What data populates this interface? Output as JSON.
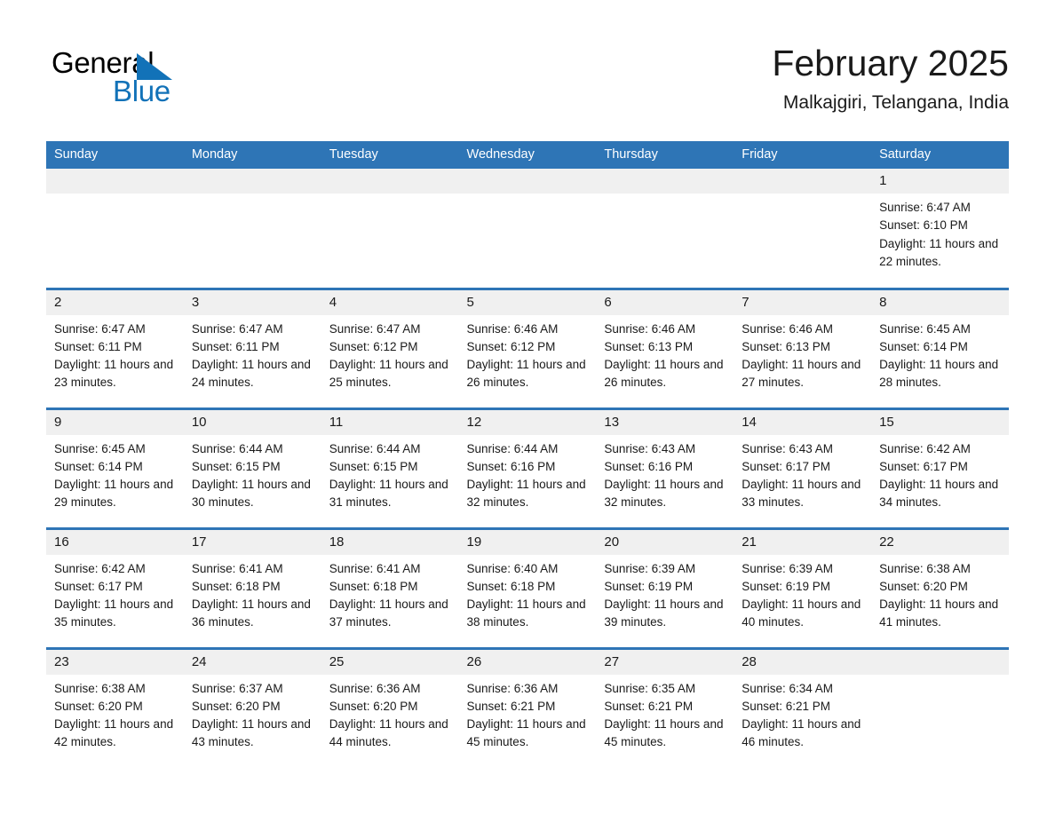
{
  "brand": {
    "name_part1": "General",
    "name_part2": "Blue",
    "accent_color": "#1272b8"
  },
  "header": {
    "title": "February 2025",
    "location": "Malkajgiri, Telangana, India"
  },
  "theme": {
    "header_row_color": "#2e75b6",
    "day_band_color": "#f0f0f0",
    "text_color": "#1a1a1a"
  },
  "weekdays": [
    "Sunday",
    "Monday",
    "Tuesday",
    "Wednesday",
    "Thursday",
    "Friday",
    "Saturday"
  ],
  "weeks": [
    [
      {
        "day": "",
        "empty": true
      },
      {
        "day": "",
        "empty": true
      },
      {
        "day": "",
        "empty": true
      },
      {
        "day": "",
        "empty": true
      },
      {
        "day": "",
        "empty": true
      },
      {
        "day": "",
        "empty": true
      },
      {
        "day": "1",
        "sunrise": "Sunrise: 6:47 AM",
        "sunset": "Sunset: 6:10 PM",
        "daylight": "Daylight: 11 hours and 22 minutes."
      }
    ],
    [
      {
        "day": "2",
        "sunrise": "Sunrise: 6:47 AM",
        "sunset": "Sunset: 6:11 PM",
        "daylight": "Daylight: 11 hours and 23 minutes."
      },
      {
        "day": "3",
        "sunrise": "Sunrise: 6:47 AM",
        "sunset": "Sunset: 6:11 PM",
        "daylight": "Daylight: 11 hours and 24 minutes."
      },
      {
        "day": "4",
        "sunrise": "Sunrise: 6:47 AM",
        "sunset": "Sunset: 6:12 PM",
        "daylight": "Daylight: 11 hours and 25 minutes."
      },
      {
        "day": "5",
        "sunrise": "Sunrise: 6:46 AM",
        "sunset": "Sunset: 6:12 PM",
        "daylight": "Daylight: 11 hours and 26 minutes."
      },
      {
        "day": "6",
        "sunrise": "Sunrise: 6:46 AM",
        "sunset": "Sunset: 6:13 PM",
        "daylight": "Daylight: 11 hours and 26 minutes."
      },
      {
        "day": "7",
        "sunrise": "Sunrise: 6:46 AM",
        "sunset": "Sunset: 6:13 PM",
        "daylight": "Daylight: 11 hours and 27 minutes."
      },
      {
        "day": "8",
        "sunrise": "Sunrise: 6:45 AM",
        "sunset": "Sunset: 6:14 PM",
        "daylight": "Daylight: 11 hours and 28 minutes."
      }
    ],
    [
      {
        "day": "9",
        "sunrise": "Sunrise: 6:45 AM",
        "sunset": "Sunset: 6:14 PM",
        "daylight": "Daylight: 11 hours and 29 minutes."
      },
      {
        "day": "10",
        "sunrise": "Sunrise: 6:44 AM",
        "sunset": "Sunset: 6:15 PM",
        "daylight": "Daylight: 11 hours and 30 minutes."
      },
      {
        "day": "11",
        "sunrise": "Sunrise: 6:44 AM",
        "sunset": "Sunset: 6:15 PM",
        "daylight": "Daylight: 11 hours and 31 minutes."
      },
      {
        "day": "12",
        "sunrise": "Sunrise: 6:44 AM",
        "sunset": "Sunset: 6:16 PM",
        "daylight": "Daylight: 11 hours and 32 minutes."
      },
      {
        "day": "13",
        "sunrise": "Sunrise: 6:43 AM",
        "sunset": "Sunset: 6:16 PM",
        "daylight": "Daylight: 11 hours and 32 minutes."
      },
      {
        "day": "14",
        "sunrise": "Sunrise: 6:43 AM",
        "sunset": "Sunset: 6:17 PM",
        "daylight": "Daylight: 11 hours and 33 minutes."
      },
      {
        "day": "15",
        "sunrise": "Sunrise: 6:42 AM",
        "sunset": "Sunset: 6:17 PM",
        "daylight": "Daylight: 11 hours and 34 minutes."
      }
    ],
    [
      {
        "day": "16",
        "sunrise": "Sunrise: 6:42 AM",
        "sunset": "Sunset: 6:17 PM",
        "daylight": "Daylight: 11 hours and 35 minutes."
      },
      {
        "day": "17",
        "sunrise": "Sunrise: 6:41 AM",
        "sunset": "Sunset: 6:18 PM",
        "daylight": "Daylight: 11 hours and 36 minutes."
      },
      {
        "day": "18",
        "sunrise": "Sunrise: 6:41 AM",
        "sunset": "Sunset: 6:18 PM",
        "daylight": "Daylight: 11 hours and 37 minutes."
      },
      {
        "day": "19",
        "sunrise": "Sunrise: 6:40 AM",
        "sunset": "Sunset: 6:18 PM",
        "daylight": "Daylight: 11 hours and 38 minutes."
      },
      {
        "day": "20",
        "sunrise": "Sunrise: 6:39 AM",
        "sunset": "Sunset: 6:19 PM",
        "daylight": "Daylight: 11 hours and 39 minutes."
      },
      {
        "day": "21",
        "sunrise": "Sunrise: 6:39 AM",
        "sunset": "Sunset: 6:19 PM",
        "daylight": "Daylight: 11 hours and 40 minutes."
      },
      {
        "day": "22",
        "sunrise": "Sunrise: 6:38 AM",
        "sunset": "Sunset: 6:20 PM",
        "daylight": "Daylight: 11 hours and 41 minutes."
      }
    ],
    [
      {
        "day": "23",
        "sunrise": "Sunrise: 6:38 AM",
        "sunset": "Sunset: 6:20 PM",
        "daylight": "Daylight: 11 hours and 42 minutes."
      },
      {
        "day": "24",
        "sunrise": "Sunrise: 6:37 AM",
        "sunset": "Sunset: 6:20 PM",
        "daylight": "Daylight: 11 hours and 43 minutes."
      },
      {
        "day": "25",
        "sunrise": "Sunrise: 6:36 AM",
        "sunset": "Sunset: 6:20 PM",
        "daylight": "Daylight: 11 hours and 44 minutes."
      },
      {
        "day": "26",
        "sunrise": "Sunrise: 6:36 AM",
        "sunset": "Sunset: 6:21 PM",
        "daylight": "Daylight: 11 hours and 45 minutes."
      },
      {
        "day": "27",
        "sunrise": "Sunrise: 6:35 AM",
        "sunset": "Sunset: 6:21 PM",
        "daylight": "Daylight: 11 hours and 45 minutes."
      },
      {
        "day": "28",
        "sunrise": "Sunrise: 6:34 AM",
        "sunset": "Sunset: 6:21 PM",
        "daylight": "Daylight: 11 hours and 46 minutes."
      },
      {
        "day": "",
        "empty": true
      }
    ]
  ]
}
